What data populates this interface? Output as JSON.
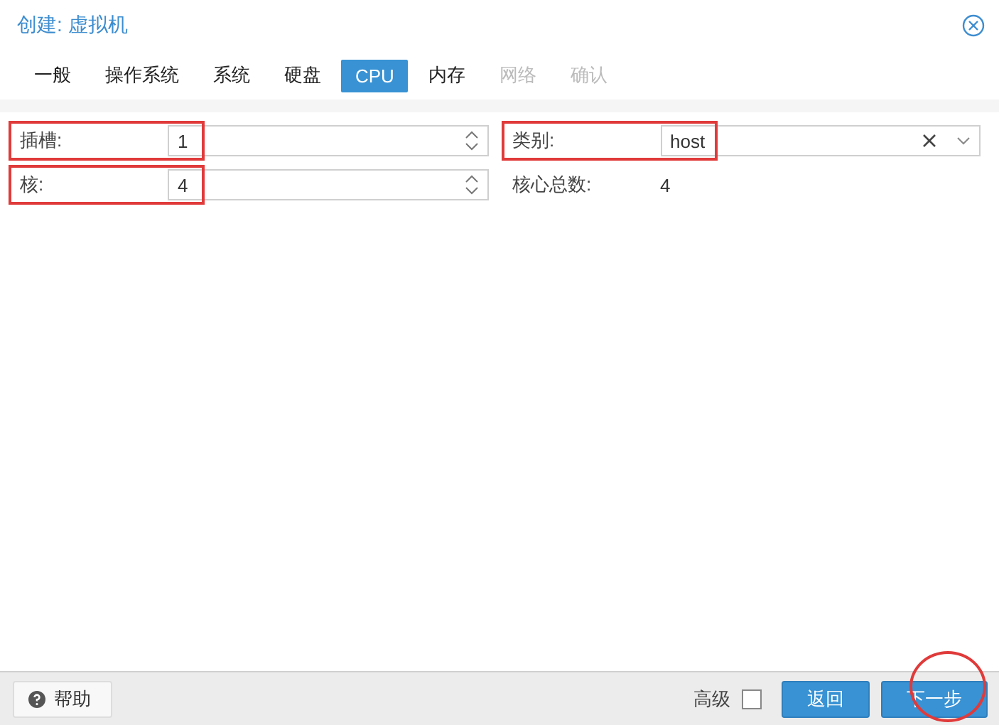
{
  "window": {
    "title": "创建: 虚拟机"
  },
  "tabs": [
    {
      "label": "一般",
      "selected": false,
      "disabled": false
    },
    {
      "label": "操作系统",
      "selected": false,
      "disabled": false
    },
    {
      "label": "系统",
      "selected": false,
      "disabled": false
    },
    {
      "label": "硬盘",
      "selected": false,
      "disabled": false
    },
    {
      "label": "CPU",
      "selected": true,
      "disabled": false
    },
    {
      "label": "内存",
      "selected": false,
      "disabled": false
    },
    {
      "label": "网络",
      "selected": false,
      "disabled": true
    },
    {
      "label": "确认",
      "selected": false,
      "disabled": true
    }
  ],
  "left_fields": [
    {
      "kind": "spinner",
      "label": "插槽:",
      "value": "1",
      "highlighted": true
    },
    {
      "kind": "spinner",
      "label": "核:",
      "value": "4",
      "highlighted": true
    }
  ],
  "right_fields": [
    {
      "kind": "combo",
      "label": "类别:",
      "value": "host",
      "highlighted": true
    },
    {
      "kind": "display",
      "label": "核心总数:",
      "value": "4"
    }
  ],
  "footer": {
    "help": "帮助",
    "advanced": {
      "label": "高级",
      "checked": false
    },
    "back": "返回",
    "next": {
      "label": "下一步",
      "highlighted": true
    }
  }
}
